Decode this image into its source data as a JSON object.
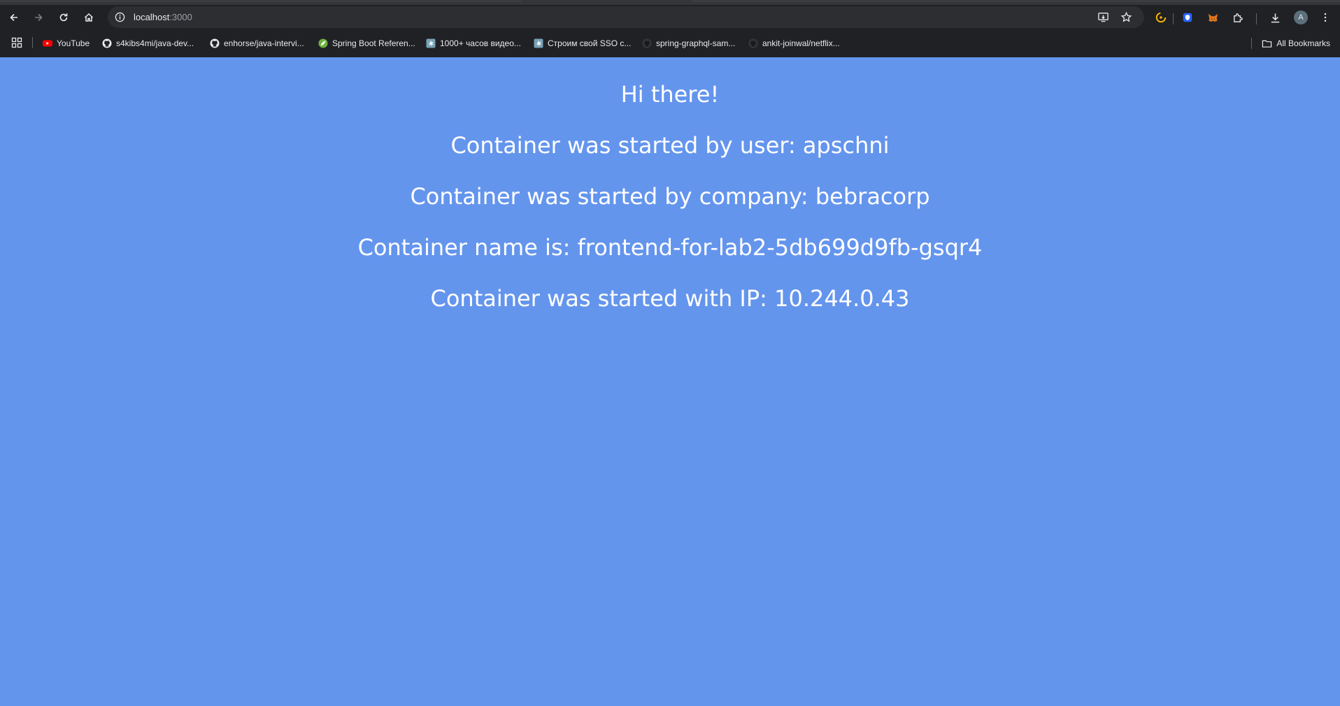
{
  "browser": {
    "address": {
      "host": "localhost",
      "port": ":3000"
    },
    "avatar_initial": "A",
    "bookmarks": [
      {
        "label": "YouTube",
        "icon": "youtube-icon"
      },
      {
        "label": "s4kibs4mi/java-dev...",
        "icon": "github-icon"
      },
      {
        "label": "enhorse/java-intervi...",
        "icon": "github-icon"
      },
      {
        "label": "Spring Boot Referen...",
        "icon": "spring-icon"
      },
      {
        "label": "1000+ часов видео...",
        "icon": "habr-icon"
      },
      {
        "label": "Строим свой SSO с...",
        "icon": "habr-icon"
      },
      {
        "label": "spring-graphql-sam...",
        "icon": "github-dark-icon"
      },
      {
        "label": "ankit-joinwal/netflix...",
        "icon": "github-dark-icon"
      }
    ],
    "all_bookmarks_label": "All Bookmarks"
  },
  "page": {
    "background": "#6495ed",
    "lines": [
      "Hi there!",
      "Container was started by user: apschni",
      "Container was started by company: bebracorp",
      "Container name is: frontend-for-lab2-5db699d9fb-gsqr4",
      "Container was started with IP: 10.244.0.43"
    ]
  }
}
